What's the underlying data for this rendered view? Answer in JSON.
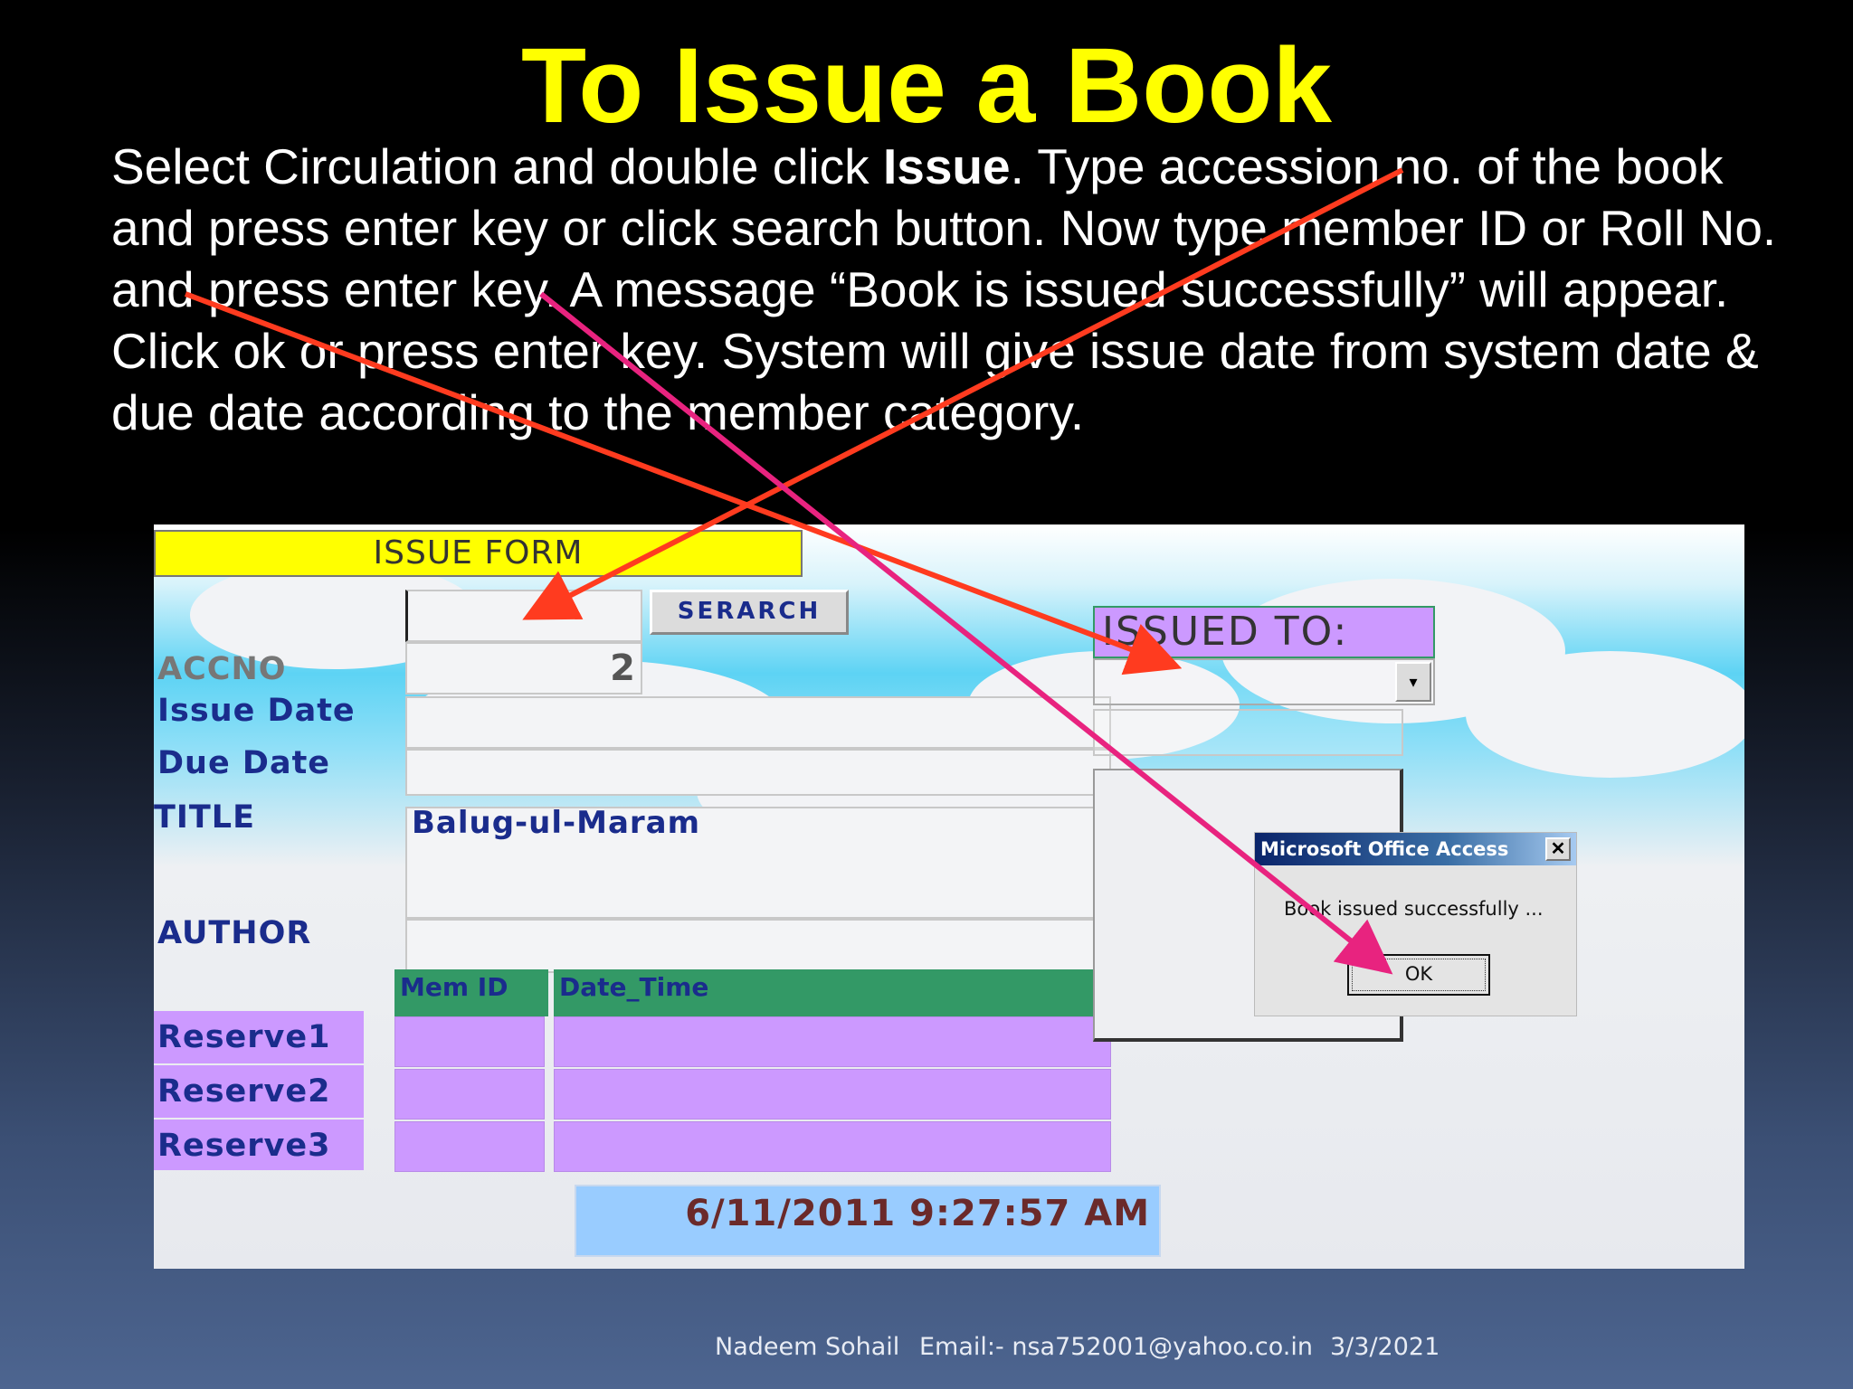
{
  "slide": {
    "title": "To Issue a Book",
    "body_pre": "Select Circulation and double click ",
    "body_bold": "Issue",
    "body_post": ". Type accession no. of the book and press enter key or click search button. Now type member ID or Roll No. and press enter key. A message “Book is issued successfully” will appear. Click ok or press enter key. System will give issue date from system date & due date according to the member category."
  },
  "form": {
    "header": "ISSUE FORM",
    "search_button": "SERARCH",
    "accno_label": "ACCNO",
    "accno_value": "2",
    "issue_date_label": "Issue Date",
    "due_date_label": "Due Date",
    "title_label": "TITLE",
    "title_value": "Balug-ul-Maram",
    "author_label": "AUTHOR",
    "grid_headers": [
      "Mem ID",
      "Date_Time"
    ],
    "reserve_labels": [
      "Reserve1",
      "Reserve2",
      "Reserve3"
    ],
    "datetime": "6/11/2011 9:27:57 AM",
    "issued_to_label": "ISSUED TO:",
    "combo_arrow": "▾"
  },
  "dialog": {
    "title": "Microsoft Office Access",
    "close": "✕",
    "message": "Book issued successfully ...",
    "ok": "OK"
  },
  "colors": {
    "title": "#ffff00",
    "arrow_red": "#ff3b1f",
    "arrow_pink": "#e8237f"
  },
  "footer": {
    "author": "Nadeem Sohail",
    "email": "Email:- nsa752001@yahoo.co.in",
    "date": "3/3/2021"
  }
}
